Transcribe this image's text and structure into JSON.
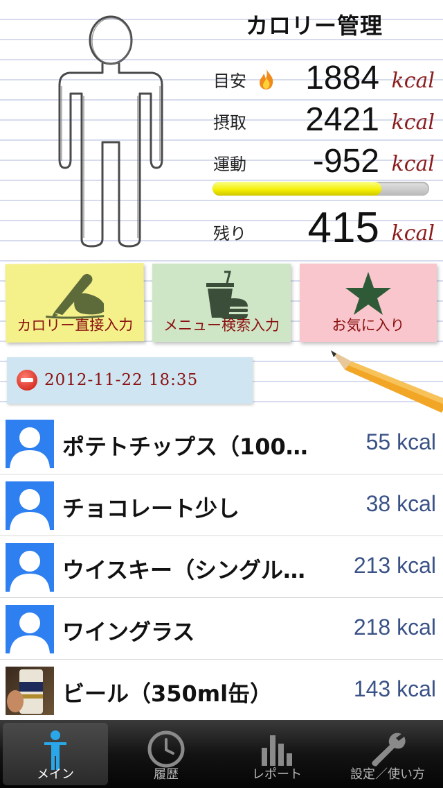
{
  "header": {
    "title": "カロリー管理"
  },
  "stats": {
    "target": {
      "label": "目安",
      "value": "1884",
      "unit": "kcal"
    },
    "intake": {
      "label": "摂取",
      "value": "2421",
      "unit": "kcal"
    },
    "exercise": {
      "label": "運動",
      "value": "-952",
      "unit": "kcal"
    },
    "remaining": {
      "label": "残り",
      "value": "415",
      "unit": "kcal"
    },
    "progress_fraction": 0.78
  },
  "actions": {
    "direct_input": "カロリー直接入力",
    "menu_search": "メニュー検索入力",
    "favorites": "お気に入り"
  },
  "date": {
    "text": "2012-11-22 18:35"
  },
  "entries": [
    {
      "name": "ポテトチップス（100…",
      "calories": "55 kcal"
    },
    {
      "name": "チョコレート少し",
      "calories": "38 kcal"
    },
    {
      "name": "ウイスキー（シングル…",
      "calories": "213 kcal"
    },
    {
      "name": "ワイングラス",
      "calories": "218 kcal"
    },
    {
      "name": "ビール（350ml缶）",
      "calories": "143 kcal"
    }
  ],
  "tabs": [
    {
      "label": "メイン",
      "icon": "person-icon",
      "active": true
    },
    {
      "label": "履歴",
      "icon": "clock-icon",
      "active": false
    },
    {
      "label": "レポート",
      "icon": "bar-chart-icon",
      "active": false
    },
    {
      "label": "設定／使い方",
      "icon": "wrench-icon",
      "active": false
    }
  ],
  "colors": {
    "unit_red": "#8b1c1c",
    "calorie_blue": "#3a5286",
    "note_yellow": "#f4f08a",
    "note_green": "#cfe6c6",
    "note_pink": "#f8c6cc",
    "date_blue": "#cfe6f2"
  }
}
